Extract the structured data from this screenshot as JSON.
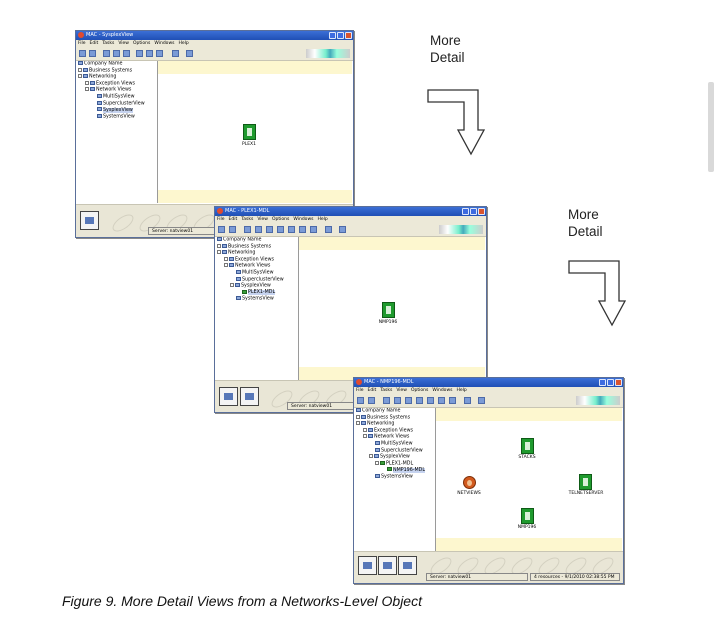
{
  "annotations": [
    {
      "line1": "More",
      "line2": "Detail"
    },
    {
      "line1": "More",
      "line2": "Detail"
    }
  ],
  "caption": "Figure 9. More Detail Views from a Networks-Level Object",
  "menu_items": [
    "File",
    "Edit",
    "Tasks",
    "View",
    "Options",
    "Windows",
    "Help"
  ],
  "windows": [
    {
      "title": "MAC - SysplexView",
      "tree": [
        {
          "label": "Company Name",
          "level": 0
        },
        {
          "label": "Business Systems",
          "level": 0,
          "expander": true
        },
        {
          "label": "Networking",
          "level": 0,
          "expander": true
        },
        {
          "label": "Exception Views",
          "level": 1,
          "expander": true
        },
        {
          "label": "Network Views",
          "level": 1,
          "expander": true
        },
        {
          "label": "MultiSysView",
          "level": 2
        },
        {
          "label": "SuperclusterView",
          "level": 2
        },
        {
          "label": "SysplexView",
          "level": 2,
          "selected": true
        },
        {
          "label": "SystemsView",
          "level": 2
        }
      ],
      "nodes": [
        {
          "label": "PLEX1"
        }
      ],
      "server": "Server: natview01"
    },
    {
      "title": "MAC - PLEX1-MDL",
      "tree": [
        {
          "label": "Company Name",
          "level": 0
        },
        {
          "label": "Business Systems",
          "level": 0,
          "expander": true
        },
        {
          "label": "Networking",
          "level": 0,
          "expander": true
        },
        {
          "label": "Exception Views",
          "level": 1,
          "expander": true
        },
        {
          "label": "Network Views",
          "level": 1,
          "expander": true
        },
        {
          "label": "MultiSysView",
          "level": 2
        },
        {
          "label": "SuperclusterView",
          "level": 2
        },
        {
          "label": "SysplexView",
          "level": 2,
          "expander": true
        },
        {
          "label": "PLEX1-MDL",
          "level": 3,
          "selected": true,
          "green": true
        },
        {
          "label": "SystemsView",
          "level": 2
        }
      ],
      "nodes": [
        {
          "label": "NMP196"
        }
      ],
      "server": "Server: natview01"
    },
    {
      "title": "MAC - NMP196-MDL",
      "tree": [
        {
          "label": "Company Name",
          "level": 0
        },
        {
          "label": "Business Systems",
          "level": 0,
          "expander": true
        },
        {
          "label": "Networking",
          "level": 0,
          "expander": true
        },
        {
          "label": "Exception Views",
          "level": 1,
          "expander": true
        },
        {
          "label": "Network Views",
          "level": 1,
          "expander": true
        },
        {
          "label": "MultiSysView",
          "level": 2
        },
        {
          "label": "SuperclusterView",
          "level": 2
        },
        {
          "label": "SysplexView",
          "level": 2,
          "expander": true
        },
        {
          "label": "PLEX1-MDL",
          "level": 3,
          "expander": true,
          "green": true
        },
        {
          "label": "NMP196-MDL",
          "level": 4,
          "selected": true,
          "green": true
        },
        {
          "label": "SystemsView",
          "level": 2
        }
      ],
      "nodes": [
        {
          "label": "STACKS"
        },
        {
          "label": "NETVIEWS"
        },
        {
          "label": "TELNETSERVER"
        },
        {
          "label": "NMP196"
        }
      ],
      "server": "Server: natview01",
      "status_right": "4 resources - 9/1/2010 02:38:55 PM"
    }
  ]
}
